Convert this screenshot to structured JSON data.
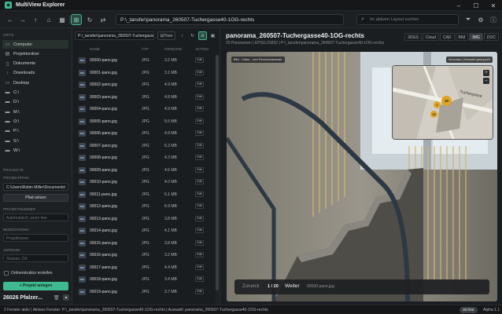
{
  "app": {
    "title": "MultiView Explorer"
  },
  "toolbar": {
    "path": "P:\\_tansfer\\panorama_260507-Tuchergasse40-1OG-rechts",
    "search_placeholder": "Im aktiven Layout suchen"
  },
  "sidebar": {
    "places_label": "ORTE",
    "places": [
      {
        "label": "Computer",
        "icon": "computer-icon"
      },
      {
        "label": "Projektordner",
        "icon": "folder-icon"
      },
      {
        "label": "Dokumente",
        "icon": "document-icon"
      },
      {
        "label": "Downloads",
        "icon": "download-icon"
      },
      {
        "label": "Desktop",
        "icon": "desktop-icon"
      },
      {
        "label": "C:\\",
        "icon": "drive-icon"
      },
      {
        "label": "D:\\",
        "icon": "drive-icon"
      },
      {
        "label": "M:\\",
        "icon": "drive-icon"
      },
      {
        "label": "O:\\",
        "icon": "drive-icon"
      },
      {
        "label": "P:\\",
        "icon": "drive-icon"
      },
      {
        "label": "S:\\",
        "icon": "drive-icon"
      },
      {
        "label": "W:\\",
        "icon": "drive-icon"
      }
    ],
    "projects_label": "PROJEKTE",
    "project_path_label": "PROJEKTPFAD",
    "project_path_value": "C:\\Users\\Robin Miller\\Documents\\",
    "set_path_button": "Pfad setzen",
    "project_number_label": "PROJEKTNUMMER",
    "project_number_placeholder": "Automatisch, wenn leer",
    "project_name_label": "BEZEICHNUNG",
    "project_name_placeholder": "Projektname",
    "address_label": "ADRESSE",
    "address_placeholder": "Strasse, Ort",
    "create_structure_label": "Ordnerstruktur erstellen",
    "create_project_button": "Projekt anlegen",
    "recent_project": "26026 Pfalzer..."
  },
  "filepanel": {
    "path": "P:\\_tansfer\\panorama_260507-Tuchergasse40-1OG-rechts",
    "tree_button": "Tree",
    "columns": {
      "name": "NAME",
      "type": "TYP",
      "size": "GROESSE",
      "action": "AKTION"
    },
    "files": [
      {
        "name": "00000-pano.jpg",
        "type": "JPG",
        "size": "3.2 MB"
      },
      {
        "name": "00001-pano.jpg",
        "type": "JPG",
        "size": "3.1 MB"
      },
      {
        "name": "00002-pano.jpg",
        "type": "JPG",
        "size": "4.9 MB"
      },
      {
        "name": "00003-pano.jpg",
        "type": "JPG",
        "size": "4.8 MB"
      },
      {
        "name": "00004-pano.jpg",
        "type": "JPG",
        "size": "4.9 MB"
      },
      {
        "name": "00005-pano.jpg",
        "type": "JPG",
        "size": "5.5 MB"
      },
      {
        "name": "00006-pano.jpg",
        "type": "JPG",
        "size": "4.9 MB"
      },
      {
        "name": "00007-pano.jpg",
        "type": "JPG",
        "size": "5.3 MB"
      },
      {
        "name": "00008-pano.jpg",
        "type": "JPG",
        "size": "4.3 MB"
      },
      {
        "name": "00009-pano.jpg",
        "type": "JPG",
        "size": "4.5 MB"
      },
      {
        "name": "00010-pano.jpg",
        "type": "JPG",
        "size": "4.0 MB"
      },
      {
        "name": "00011-pano.jpg",
        "type": "JPG",
        "size": "6.1 MB"
      },
      {
        "name": "00012-pano.jpg",
        "type": "JPG",
        "size": "6.9 MB"
      },
      {
        "name": "00013-pano.jpg",
        "type": "JPG",
        "size": "3.8 MB"
      },
      {
        "name": "00014-pano.jpg",
        "type": "JPG",
        "size": "4.1 MB"
      },
      {
        "name": "00015-pano.jpg",
        "type": "JPG",
        "size": "3.8 MB"
      },
      {
        "name": "00016-pano.jpg",
        "type": "JPG",
        "size": "3.2 MB"
      },
      {
        "name": "00017-pano.jpg",
        "type": "JPG",
        "size": "4.4 MB"
      },
      {
        "name": "00018-pano.jpg",
        "type": "JPG",
        "size": "3.4 MB"
      },
      {
        "name": "00019-pano.jpg",
        "type": "JPG",
        "size": "3.7 MB"
      }
    ],
    "badge_label": "IMG",
    "edit_label": "Edit"
  },
  "preview": {
    "title": "panorama_260507-Tuchergasse40-1OG-rechts",
    "subtitle": "20 Panoramen  |  EPSG:25832  |  P:\\_tansfer\\panorama_260507-Tuchergasse40-1OG-rechts",
    "tabs": [
      "3DGS",
      "Cloud",
      "CAD",
      "BIM",
      "IMG",
      "DOC"
    ],
    "active_tab": "IMG",
    "viewer_chip": "Bild - Video - und Panoramaviewer",
    "viewer_chip_right": "Vorschau | Auswahl gekoppelt",
    "map_street": "Tuchergasse",
    "map_markers": [
      "20",
      "1",
      "19"
    ],
    "prev_label": "Zurueck",
    "counter": "1 / 20",
    "next_label": "Weiter",
    "current_file": "00000-pano.jpg"
  },
  "status": {
    "text": "2 Fenster aktiv  |  Aktives Fenster: P:\\_tansfer\\panorama_260507-Tuchergasse40-1OG-rechts  |  Auswahl: panorama_260507-Tuchergasse40-1OG-rechts",
    "mode_pill": "3D-first",
    "version": "Alpha 1.1"
  },
  "colors": {
    "accent": "#3fb98f",
    "background": "#1b1e21",
    "panel": "#1d2023"
  }
}
